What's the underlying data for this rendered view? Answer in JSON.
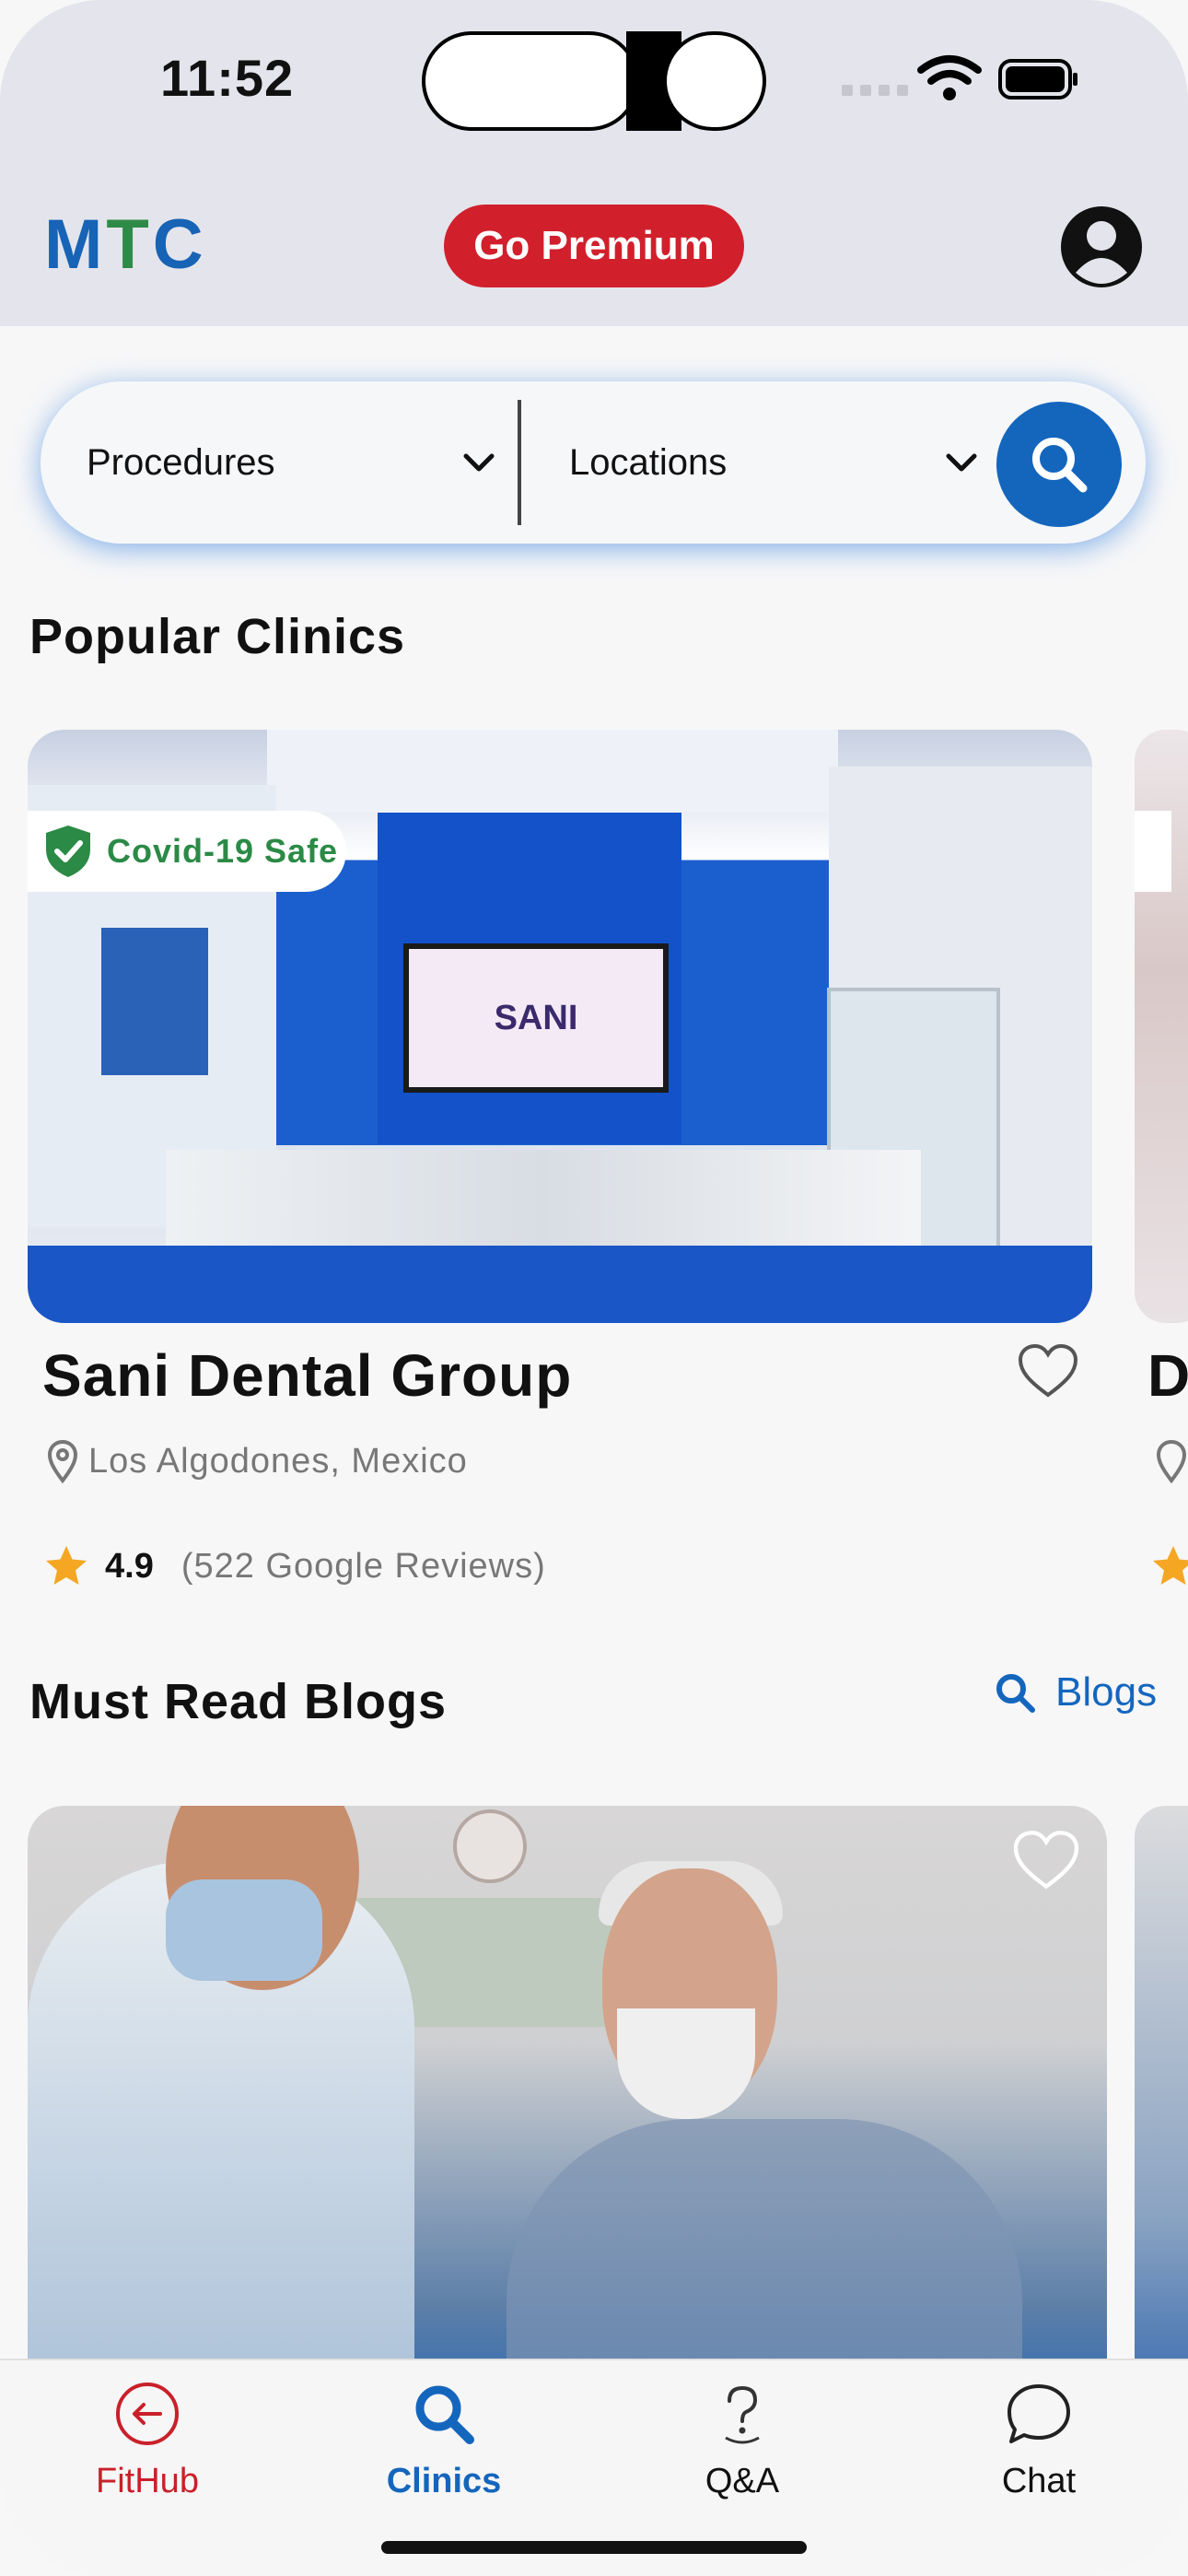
{
  "status_bar": {
    "time": "11:52"
  },
  "header": {
    "logo_m": "M",
    "logo_t": "T",
    "logo_c": "C",
    "premium_button": "Go Premium",
    "profile_icon": "person-circle-icon"
  },
  "search": {
    "procedures_label": "Procedures",
    "locations_label": "Locations",
    "search_icon": "search-icon"
  },
  "popular": {
    "title": "Popular Clinics",
    "clinic": {
      "badge": "Covid-19 Safe",
      "image_sign": "SANI",
      "name": "Sani Dental Group",
      "location": "Los Algodones, Mexico",
      "rating": "4.9",
      "reviews": "(522 Google Reviews)"
    },
    "next_clinic_initial": "D"
  },
  "blogs": {
    "title": "Must Read Blogs",
    "link_label": "Blogs"
  },
  "tabbar": {
    "tabs": [
      {
        "label": "FitHub",
        "icon": "back-arrow-circle-icon"
      },
      {
        "label": "Clinics",
        "icon": "search-icon"
      },
      {
        "label": "Q&A",
        "icon": "question-bubble-icon"
      },
      {
        "label": "Chat",
        "icon": "chat-bubble-icon"
      }
    ]
  },
  "colors": {
    "brand_blue": "#1466bd",
    "brand_green": "#2e8b47",
    "premium_red": "#d1202c",
    "safe_green": "#2b8a46",
    "star": "#f5a623"
  }
}
